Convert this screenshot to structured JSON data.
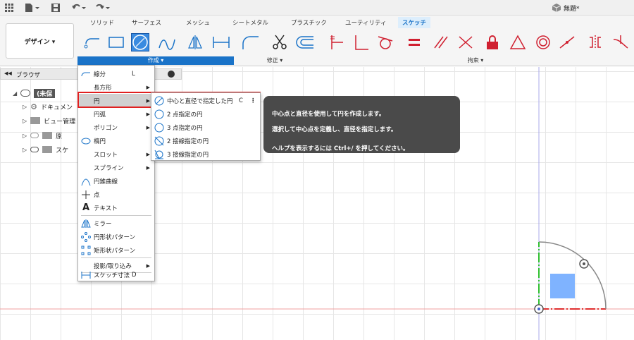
{
  "app": {
    "doc_title": "無題*"
  },
  "tabs": [
    "ソリッド",
    "サーフェス",
    "メッシュ",
    "シートメタル",
    "プラスチック",
    "ユーティリティ",
    "スケッチ"
  ],
  "ribbon": {
    "workspace": "デザイン ▾",
    "groups": {
      "create": "作成 ▾",
      "modify": "修正 ▾",
      "constraints": "拘束 ▾"
    }
  },
  "browser": {
    "title": "ブラウザ",
    "items": [
      "(未保",
      "ドキュメン",
      "ビュー管理",
      "原",
      "スケ"
    ]
  },
  "create_menu": {
    "items": [
      {
        "label": "線分",
        "shortcut": "L"
      },
      {
        "label": "長方形"
      },
      {
        "label": "円"
      },
      {
        "label": "円弧"
      },
      {
        "label": "ポリゴン"
      },
      {
        "label": "楕円"
      },
      {
        "label": "スロット"
      },
      {
        "label": "スプライン"
      },
      {
        "label": "円錐曲線"
      },
      {
        "label": "点"
      },
      {
        "label": "テキスト"
      },
      {
        "label": "ミラー"
      },
      {
        "label": "円形状パターン"
      },
      {
        "label": "矩形状パターン"
      },
      {
        "label": "投影/取り込み"
      },
      {
        "label": "スケッチ寸法",
        "shortcut": "D"
      }
    ]
  },
  "circle_submenu": {
    "items": [
      {
        "label": "中心と直径で指定した円",
        "shortcut": "C"
      },
      {
        "label": "2 点指定の円"
      },
      {
        "label": "3 点指定の円"
      },
      {
        "label": "2 接線指定の円"
      },
      {
        "label": "3 接線指定の円"
      }
    ]
  },
  "tooltip": {
    "line1": "中心点と直径を使用して円を作成します。",
    "line2": "選択して中心点を定義し、直径を指定します。",
    "line3": "ヘルプを表示するには Ctrl+/ を押してください。"
  },
  "colors": {
    "accent": "#1a73c8",
    "highlight_border": "#e02020",
    "constraint_red": "#d02030",
    "x_axis": "#e03030",
    "y_axis": "#30c030"
  }
}
